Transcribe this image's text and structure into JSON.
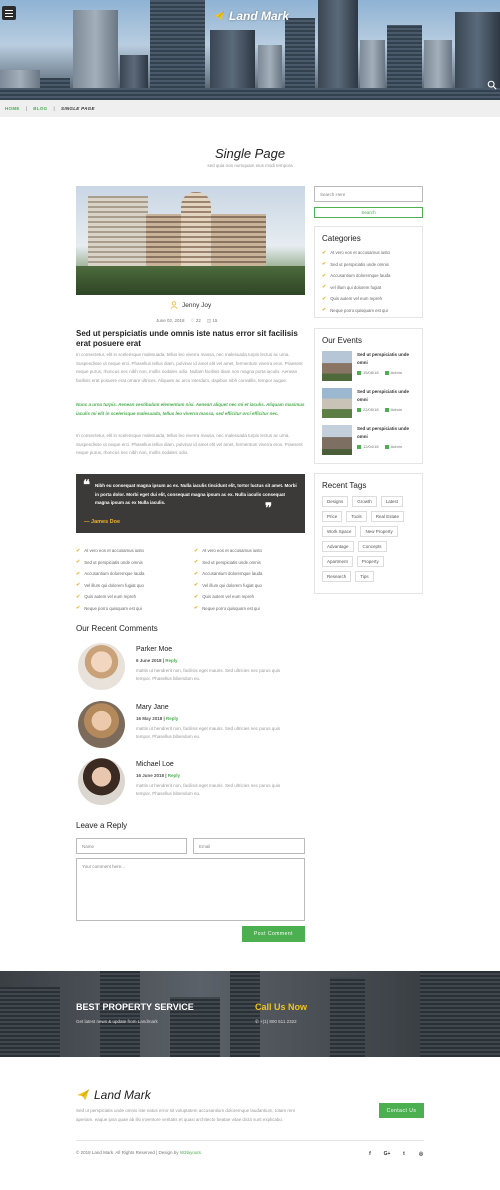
{
  "header": {
    "logo_text": "Land Mark",
    "menu_icon": "hamburger-icon",
    "search_icon": "search-icon"
  },
  "breadcrumb": {
    "home": "HOME",
    "blog": "BLOG",
    "current": "SINGLE PAGE",
    "separator": "|"
  },
  "page": {
    "title": "Single Page",
    "subtitle": "sed quia non numquam eius modi tempora"
  },
  "post": {
    "author": "Jenny Joy",
    "date": "June 02, 2018",
    "likes": "22",
    "comments_count": "15",
    "heading": "Sed ut perspiciatis unde omnis iste natus error sit facilisis erat posuere erat",
    "paragraph1": "In consectetur, elit in scelerisque malesuada, tellus leo viverra massa, nec malesuada turpis lectus ac urna. Suspendisse ut neque erci. Phasellus tellus diam, pulvinar id amet elit vel amet, fermentum viverra eros. Praesent neque purus, rhoncus nec nibh non, mollis sodales odio. Nullam facilisis diam non magna porta iaculis. Aenean facilisis erat posuere erat ornare ultrices. Aliquam ac arcu interdum, dapibus nibh convallis, tempor augue.",
    "green_text": "Nunc a urna turpis. Aenean vestibulum elementum nisi. Aenean aliquet nec mi et iaculis. Aliquam maximus iaculis mi elit in scelerisque malesuada, tellus leo viverra massa, sed efficitur orci efficitur nec.",
    "paragraph2": "In consectetur, elit in scelerisque malesuada, tellus leo viverra massa, nec malesuada turpis lectus ac urna. Suspendisse ut neque erci. Phasellus tellus diam, pulvinar id amet elit vel amet, fermentum viverra eros. Praesent neque purus, rhoncus nec nibh non, mollis sodales odio.",
    "quote_text": "Nibh eu consequat magna ipsum ac ex. Nulla iaculis tincidunt elit, tortor luctus sit amet. Morbi in porta dolor. Morbi eget dui elit, consequat magna ipsum ac ex. Nulla iaculis consequat magna ipsum ac ex Nulla iaculis.",
    "quote_author": "— James Doe",
    "checklist_left": [
      "At vero eos et accusamus iusto",
      "Sed ut perspiciatis unde omnis",
      "Accusantium doloremque lauda",
      "Vel illum qui dolorem fugiat quo",
      "Quis autem vel eum repreh",
      "Neque porro quisquam est qui"
    ],
    "checklist_right": [
      "At vero eos et accusamus iusto",
      "Sed ut perspiciatis unde omnis",
      "Accusantium doloremque lauda",
      "Vel illum qui dolorem fugiat quo",
      "Quis autem vel eum repreh",
      "Neque porro quisquam est qui"
    ]
  },
  "comments": {
    "heading": "Our Recent Comments",
    "reply_label": "Reply",
    "items": [
      {
        "name": "Parker Moe",
        "date": "6 June 2018",
        "text": "mattis ut hendrerit non, facilisis eget mauris. Sed ultricies nec purus quis tempor. Phasellus bibendum eu."
      },
      {
        "name": "Mary Jane",
        "date": "16 May 2018",
        "text": "mattis ut hendrerit non, facilisis eget mauris. Sed ultricies nec purus quis tempor. Phasellus bibendum eu."
      },
      {
        "name": "Michael Loe",
        "date": "16 June 2018",
        "text": "mattis ut hendrerit non, facilisis eget mauris. Sed ultricies nec purus quis tempor. Phasellus bibendum eu."
      }
    ]
  },
  "reply_form": {
    "heading": "Leave a Reply",
    "name_placeholder": "Name",
    "email_placeholder": "Email",
    "comment_placeholder": "Your comment here...",
    "submit_label": "Post Comment"
  },
  "sidebar": {
    "search_placeholder": "Search Here",
    "search_button": "Search",
    "categories_heading": "Categories",
    "categories": [
      "At vero eos et accusamus iusto",
      "Sed ut perspiciatis unde omnis",
      "Accusantium doloremque lauda",
      "vel illum qui dolorem fugiat",
      "Quis autem vel eum repreh",
      "Neque porro quisquam est qui"
    ],
    "events_heading": "Our Events",
    "events": [
      {
        "title": "Sed ut perspiciatis unde omni",
        "date": "15/08/18",
        "by": "Admin"
      },
      {
        "title": "Sed ut perspiciatis unde omni",
        "date": "22/05/18",
        "by": "Admin"
      },
      {
        "title": "Sed ut perspiciatis unde omni",
        "date": "12/04/18",
        "by": "Admin"
      }
    ],
    "tags_heading": "Recent Tags",
    "tags": [
      "Designs",
      "Growth",
      "Latest",
      "Price",
      "Tools",
      "Real Estate",
      "Work Space",
      "New Property",
      "Advantage",
      "Concepts",
      "Apartment",
      "Property",
      "Research",
      "Tips"
    ]
  },
  "band": {
    "heading": "BEST PROPERTY SERVICE",
    "sub": "Get latest news & update from Landmark",
    "call_heading": "Call Us Now",
    "phone": "+(1) 800 511 2322"
  },
  "footer": {
    "logo_text": "Land Mark",
    "description": "Sed ut perspiciatis unde omnis iste natus error sit voluptatem accusantium doloremque laudantium, totam rem aperiam. eaque ipsa quae ab illo inventore veritatis et quasi architecto beatae vitae dicta sunt explicabo.",
    "contact_button": "Contact Us",
    "copyright": "© 2018 Land Mark. All Rights Reserved | Design by",
    "designer": "W3layouts",
    "social": [
      "f",
      "G+",
      "t",
      "◎"
    ]
  },
  "colors": {
    "accent": "#4caf50",
    "highlight": "#f0b429",
    "dark": "#3c3a38"
  }
}
